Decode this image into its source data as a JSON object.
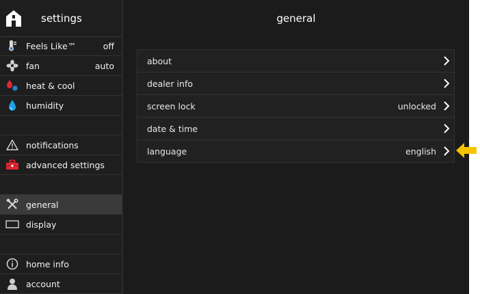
{
  "sidebar": {
    "title": "settings",
    "items": [
      {
        "label": "Feels Like™",
        "value": "off",
        "icon": "feels-like-icon"
      },
      {
        "label": "fan",
        "value": "auto",
        "icon": "fan-icon"
      },
      {
        "label": "heat & cool",
        "value": "",
        "icon": "heat-cool-icon"
      },
      {
        "label": "humidity",
        "value": "",
        "icon": "humidity-icon"
      },
      {
        "label": "notifications",
        "value": "",
        "icon": "warning-icon"
      },
      {
        "label": "advanced settings",
        "value": "",
        "icon": "toolbox-icon"
      },
      {
        "label": "general",
        "value": "",
        "icon": "tools-icon"
      },
      {
        "label": "display",
        "value": "",
        "icon": "display-icon"
      },
      {
        "label": "home info",
        "value": "",
        "icon": "info-icon"
      },
      {
        "label": "account",
        "value": "",
        "icon": "person-icon"
      }
    ]
  },
  "main": {
    "title": "general",
    "rows": [
      {
        "label": "about",
        "value": ""
      },
      {
        "label": "dealer info",
        "value": ""
      },
      {
        "label": "screen lock",
        "value": "unlocked"
      },
      {
        "label": "date & time",
        "value": ""
      },
      {
        "label": "language",
        "value": "english"
      }
    ]
  },
  "colors": {
    "background": "#1b1b1b",
    "selected": "#3a3a3a",
    "heat": "#e0272f",
    "cool": "#1e8fe0",
    "pointer": "#f5c400"
  }
}
